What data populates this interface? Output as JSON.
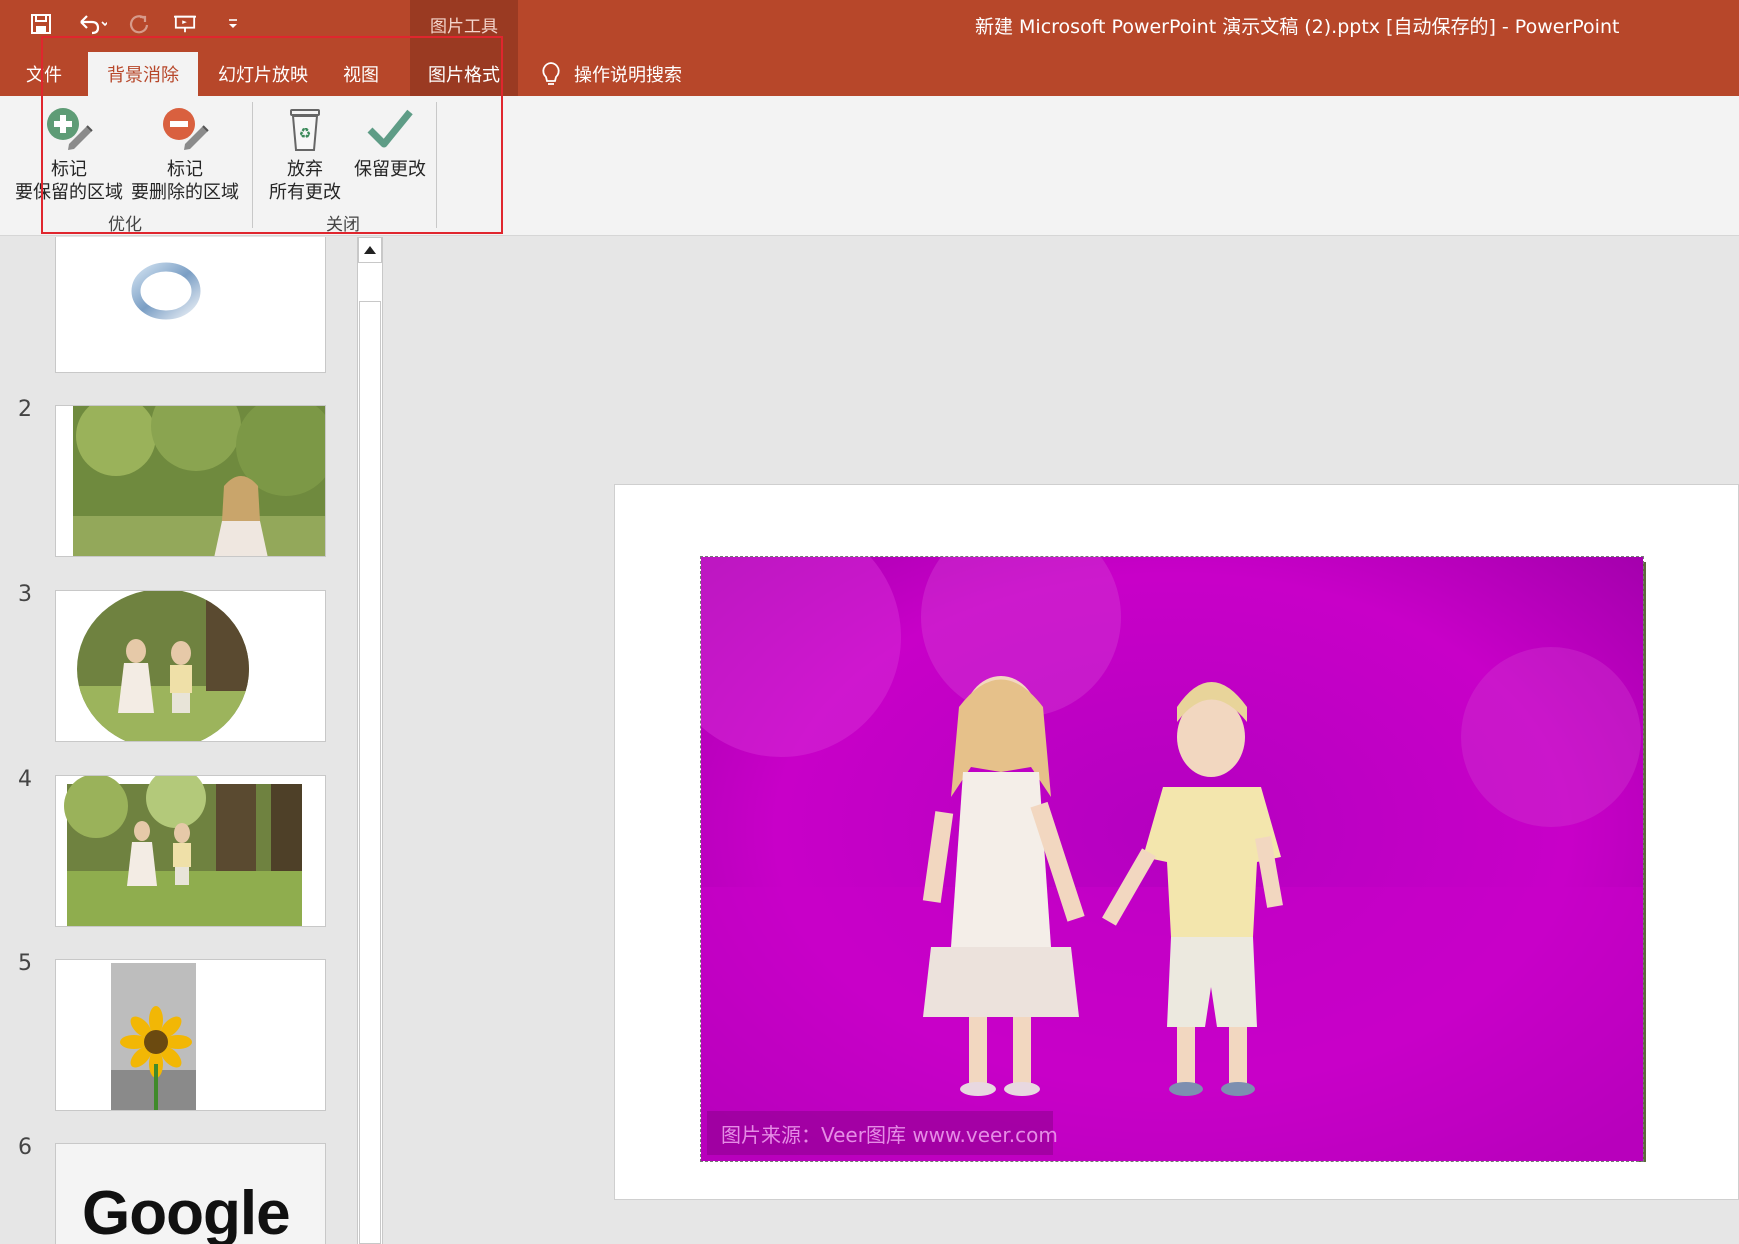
{
  "window": {
    "title": "新建 Microsoft PowerPoint 演示文稿 (2).pptx [自动保存的]  -  PowerPoint",
    "context_tab_group": "图片工具"
  },
  "tabs": {
    "file": "文件",
    "background_removal": "背景消除",
    "slide_show": "幻灯片放映",
    "view": "视图",
    "picture_format": "图片格式",
    "tell_me": "操作说明搜索"
  },
  "ribbon": {
    "refine_group": "优化",
    "close_group": "关闭",
    "mark_keep_line1": "标记",
    "mark_keep_line2": "要保留的区域",
    "mark_remove_line1": "标记",
    "mark_remove_line2": "要删除的区域",
    "discard_line1": "放弃",
    "discard_line2": "所有更改",
    "keep_changes": "保留更改"
  },
  "slides": [
    {
      "number": "",
      "kind": "ring"
    },
    {
      "number": "2",
      "kind": "girl-photo"
    },
    {
      "number": "3",
      "kind": "circle-photo"
    },
    {
      "number": "4",
      "kind": "kids-photo"
    },
    {
      "number": "5",
      "kind": "sunflower"
    },
    {
      "number": "6",
      "kind": "google-logo",
      "logo_text": "Google"
    }
  ],
  "canvas": {
    "watermark": "图片来源：Veer图库 www.veer.com",
    "removal_overlay_color": "#c800c8"
  },
  "colors": {
    "accent": "#b7472a",
    "highlight_box": "#e0262e"
  }
}
